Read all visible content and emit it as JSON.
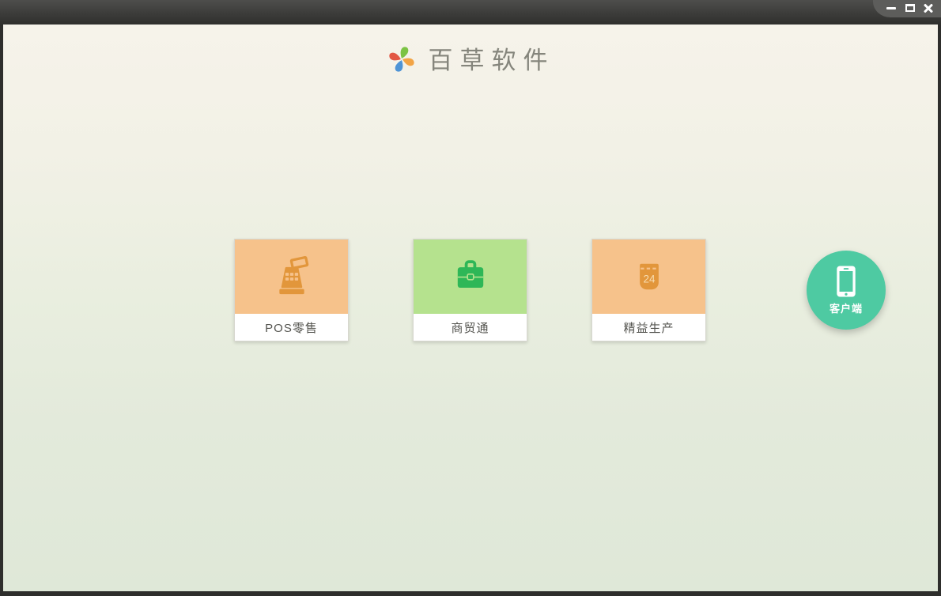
{
  "window": {
    "controls": {
      "minimize": "minimize",
      "maximize": "maximize",
      "close": "close"
    }
  },
  "header": {
    "title": "百草软件",
    "logo_petals": [
      "#7cc344",
      "#f2a445",
      "#4e94d6",
      "#e25744"
    ]
  },
  "products": [
    {
      "label": "POS零售",
      "icon": "cash-register-icon",
      "bg": "#f6c28b",
      "icon_color": "#e2963b"
    },
    {
      "label": "商贸通",
      "icon": "briefcase-icon",
      "bg": "#b5e28e",
      "icon_color": "#2eb757"
    },
    {
      "label": "精益生产",
      "icon": "calendar-icon",
      "bg": "#f6c28b",
      "icon_color": "#e2963b",
      "calendar_day": "24"
    }
  ],
  "client_button": {
    "label": "客户端",
    "bg": "#4ecaa2"
  }
}
